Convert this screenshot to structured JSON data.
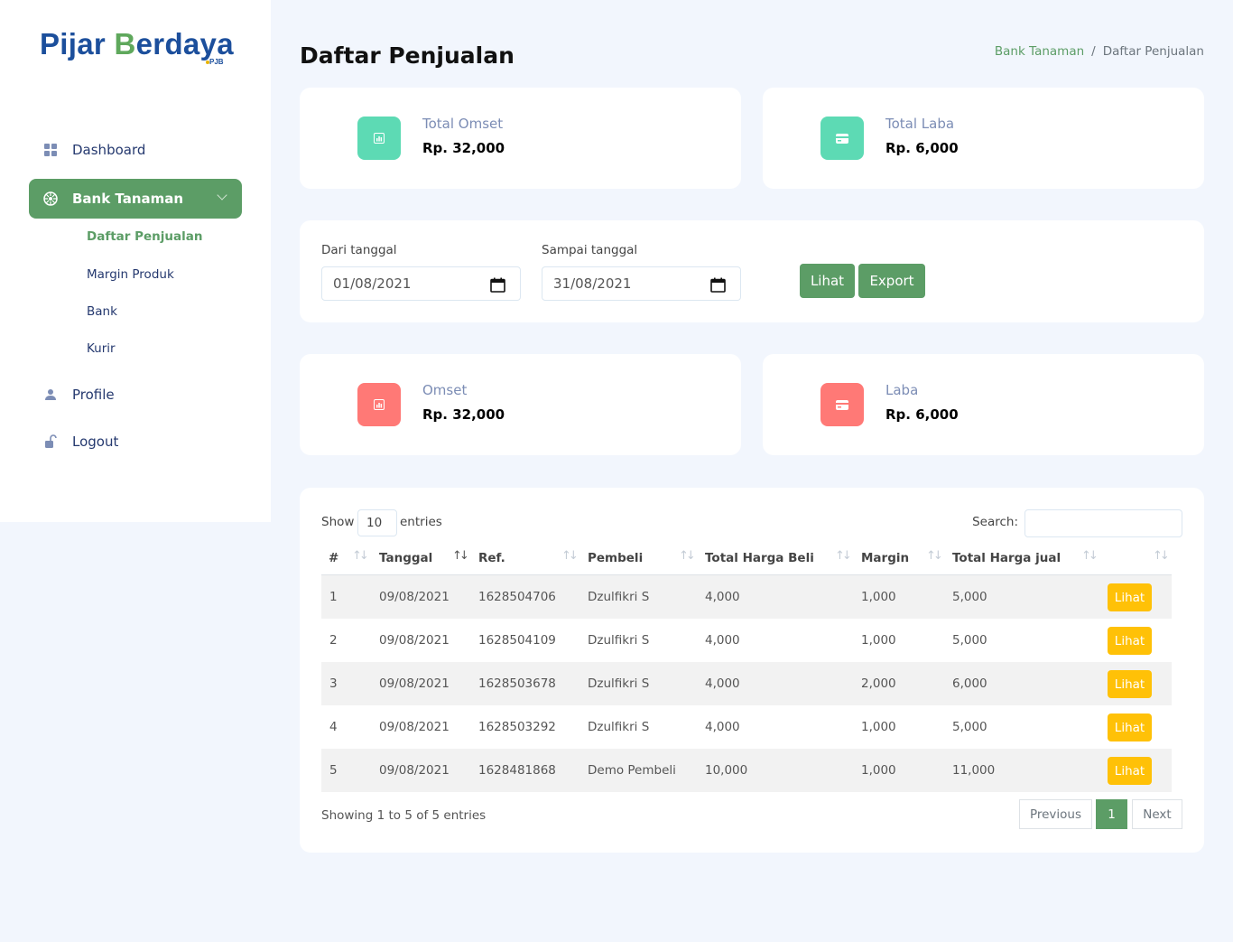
{
  "brand": {
    "name_part1": "Pi",
    "name_part2": "jar ",
    "name_part3": "B",
    "name_part4": "erdaya",
    "sub": "PJB"
  },
  "sidebar": {
    "items": [
      {
        "label": "Dashboard",
        "icon": "grid-icon"
      },
      {
        "label": "Bank Tanaman",
        "icon": "flower-icon",
        "active": true
      },
      {
        "label": "Profile",
        "icon": "person-icon"
      },
      {
        "label": "Logout",
        "icon": "unlock-icon"
      }
    ],
    "submenu": [
      {
        "label": "Daftar Penjualan",
        "active": true
      },
      {
        "label": "Margin Produk"
      },
      {
        "label": "Bank"
      },
      {
        "label": "Kurir"
      }
    ]
  },
  "header": {
    "title": "Daftar Penjualan"
  },
  "breadcrumb": {
    "parent": "Bank Tanaman",
    "separator": "/",
    "current": "Daftar Penjualan"
  },
  "stats_top": [
    {
      "label": "Total Omset",
      "value": "Rp. 32,000",
      "icon": "chart-icon",
      "color": "#5ddab4"
    },
    {
      "label": "Total Laba",
      "value": "Rp. 6,000",
      "icon": "credit-card-icon",
      "color": "#5ddab4"
    }
  ],
  "filter": {
    "from_label": "Dari tanggal",
    "from_value": "01/08/2021",
    "to_label": "Sampai tanggal",
    "to_value": "31/08/2021",
    "view_button": "Lihat",
    "export_button": "Export"
  },
  "stats_period": [
    {
      "label": "Omset",
      "value": "Rp. 32,000",
      "icon": "chart-icon",
      "color": "#ff7976"
    },
    {
      "label": "Laba",
      "value": "Rp. 6,000",
      "icon": "credit-card-icon",
      "color": "#ff7976"
    }
  ],
  "table": {
    "show_label": "Show",
    "entries_label": "entries",
    "page_length": "10",
    "search_label": "Search:",
    "columns": [
      "#",
      "Tanggal",
      "Ref.",
      "Pembeli",
      "Total Harga Beli",
      "Margin",
      "Total Harga jual",
      ""
    ],
    "rows": [
      {
        "no": "1",
        "tanggal": "09/08/2021",
        "ref": "1628504706",
        "pembeli": "Dzulfikri S",
        "beli": "4,000",
        "margin": "1,000",
        "jual": "5,000",
        "action": "Lihat"
      },
      {
        "no": "2",
        "tanggal": "09/08/2021",
        "ref": "1628504109",
        "pembeli": "Dzulfikri S",
        "beli": "4,000",
        "margin": "1,000",
        "jual": "5,000",
        "action": "Lihat"
      },
      {
        "no": "3",
        "tanggal": "09/08/2021",
        "ref": "1628503678",
        "pembeli": "Dzulfikri S",
        "beli": "4,000",
        "margin": "2,000",
        "jual": "6,000",
        "action": "Lihat"
      },
      {
        "no": "4",
        "tanggal": "09/08/2021",
        "ref": "1628503292",
        "pembeli": "Dzulfikri S",
        "beli": "4,000",
        "margin": "1,000",
        "jual": "5,000",
        "action": "Lihat"
      },
      {
        "no": "5",
        "tanggal": "09/08/2021",
        "ref": "1628481868",
        "pembeli": "Demo Pembeli",
        "beli": "10,000",
        "margin": "1,000",
        "jual": "11,000",
        "action": "Lihat"
      }
    ],
    "info": "Showing 1 to 5 of 5 entries",
    "pagination": {
      "previous": "Previous",
      "current": "1",
      "next": "Next"
    }
  },
  "colors": {
    "accent": "#5c9d66",
    "warning": "#ffc107",
    "teal": "#5ddab4",
    "red": "#ff7976",
    "background": "#f2f6fd"
  }
}
